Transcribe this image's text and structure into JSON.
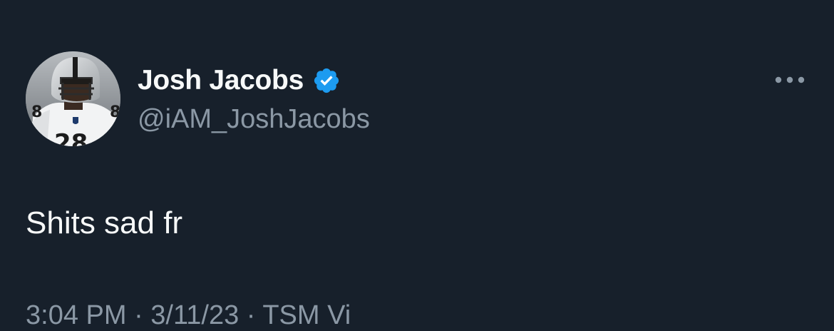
{
  "theme": {
    "background": "#17202b",
    "text_primary": "#f7f9f9",
    "text_secondary": "#8b98a5",
    "verified_badge": "#1d9bf0"
  },
  "author": {
    "display_name": "Josh Jacobs",
    "handle": "@iAM_JoshJacobs",
    "verified": true,
    "avatar_icon": "player-avatar",
    "verified_icon": "verified-badge-icon"
  },
  "tweet": {
    "text": "Shits sad fr",
    "meta": "3:04 PM · 3/11/23 · TSM Vi"
  },
  "actions": {
    "more_icon": "more-horizontal-icon"
  }
}
